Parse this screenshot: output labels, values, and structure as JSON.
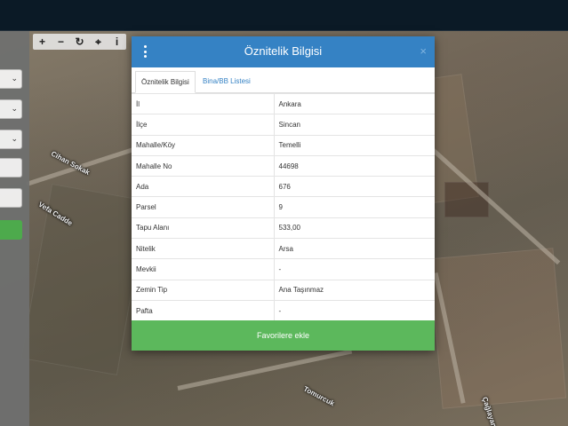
{
  "modal": {
    "title": "Öznitelik Bilgisi",
    "close_glyph": "×",
    "menu_icon": "kebab-icon",
    "tabs": [
      {
        "label": "Öznitelik Bilgisi",
        "active": true
      },
      {
        "label": "Bina/BB Listesi",
        "active": false
      }
    ],
    "rows": [
      {
        "key": "İl",
        "value": "Ankara"
      },
      {
        "key": "İlçe",
        "value": "Sincan"
      },
      {
        "key": "Mahalle/Köy",
        "value": "Temelli"
      },
      {
        "key": "Mahalle No",
        "value": "44698"
      },
      {
        "key": "Ada",
        "value": "676"
      },
      {
        "key": "Parsel",
        "value": "9"
      },
      {
        "key": "Tapu Alanı",
        "value": "533,00"
      },
      {
        "key": "Nitelik",
        "value": "Arsa"
      },
      {
        "key": "Mevkii",
        "value": "-"
      },
      {
        "key": "Zemin Tip",
        "value": "Ana Taşınmaz"
      },
      {
        "key": "Pafta",
        "value": "-"
      }
    ],
    "favorite_button": "Favorilere ekle"
  },
  "map_toolbar": {
    "zoom_in": "+",
    "zoom_out": "−",
    "refresh": "↻",
    "locate": "⌖",
    "info": "i"
  },
  "map_labels": {
    "label_1": "Cihan Sokak",
    "label_2": "Vefa Cadde",
    "label_3": "Tomurcuk",
    "label_4": "Çağlayan"
  },
  "left_panel": {
    "chevron": "⌄"
  },
  "colors": {
    "header_blue": "#3582c4",
    "button_green": "#5cb85c",
    "topbar": "#0b1a26"
  }
}
